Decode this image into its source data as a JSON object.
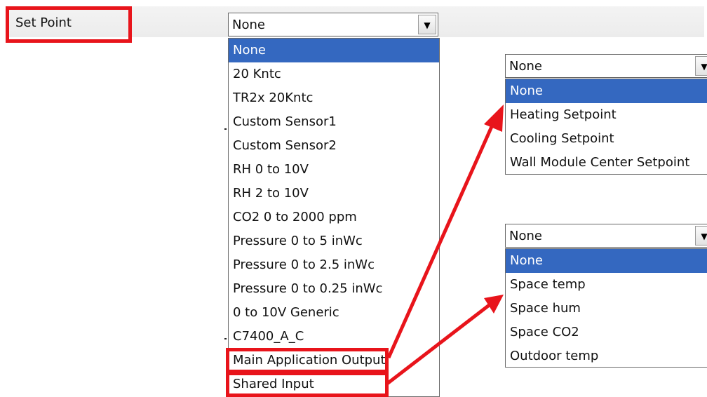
{
  "setpoint": {
    "label": "Set Point",
    "select_value": "None",
    "options": [
      "None",
      "20 Kntc",
      "TR2x 20Kntc",
      "Custom Sensor1",
      "Custom Sensor2",
      "RH 0 to 10V",
      "RH 2 to 10V",
      "CO2 0 to 2000 ppm",
      "Pressure 0 to 5 inWc",
      "Pressure 0 to 2.5 inWc",
      "Pressure 0 to 0.25 inWc",
      "0 to 10V Generic",
      "C7400_A_C",
      "Main Application Output",
      "Shared Input"
    ],
    "highlighted_index": 0
  },
  "main_app_dropdown": {
    "select_value": "None",
    "options": [
      "None",
      "Heating Setpoint",
      "Cooling Setpoint",
      "Wall Module Center Setpoint"
    ],
    "highlighted_index": 0
  },
  "shared_input_dropdown": {
    "select_value": "None",
    "options": [
      "None",
      "Space temp",
      "Space hum",
      "Space CO2",
      "Outdoor temp"
    ],
    "highlighted_index": 0
  },
  "icons": {
    "dropdown_arrow": "chevron-down-icon"
  },
  "colors": {
    "annotation_red": "#e8141b",
    "highlight_blue": "#3468c0"
  }
}
